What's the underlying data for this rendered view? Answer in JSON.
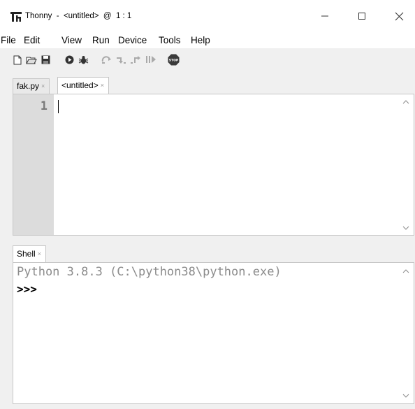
{
  "window": {
    "app_name": "Thonny",
    "title_rest": "  -  <untitled>  @  1 : 1",
    "minimize_icon": "minimize-icon",
    "maximize_icon": "maximize-icon",
    "close_icon": "close-icon"
  },
  "menu": {
    "items": [
      "File",
      "Edit",
      "View",
      "Run",
      "Device",
      "Tools",
      "Help"
    ]
  },
  "toolbar": {
    "icons": [
      "new-file-icon",
      "open-file-icon",
      "save-icon",
      "run-icon",
      "debug-icon",
      "step-over-icon",
      "step-into-icon",
      "step-out-icon",
      "resume-icon",
      "stop-icon"
    ],
    "stop_label": "STOP"
  },
  "editor": {
    "tabs": [
      {
        "label": "fak.py",
        "active": false
      },
      {
        "label": "<untitled>",
        "active": true
      }
    ],
    "tab_close_glyph": "×",
    "line_numbers": [
      "1"
    ]
  },
  "shell": {
    "tab_label": "Shell",
    "banner": "Python 3.8.3 (C:\\python38\\python.exe)",
    "prompt": ">>>"
  },
  "colors": {
    "gutter": "#dcdcdc",
    "banner_text": "#8c8c8c",
    "stop_button": "#7a1a1a"
  }
}
